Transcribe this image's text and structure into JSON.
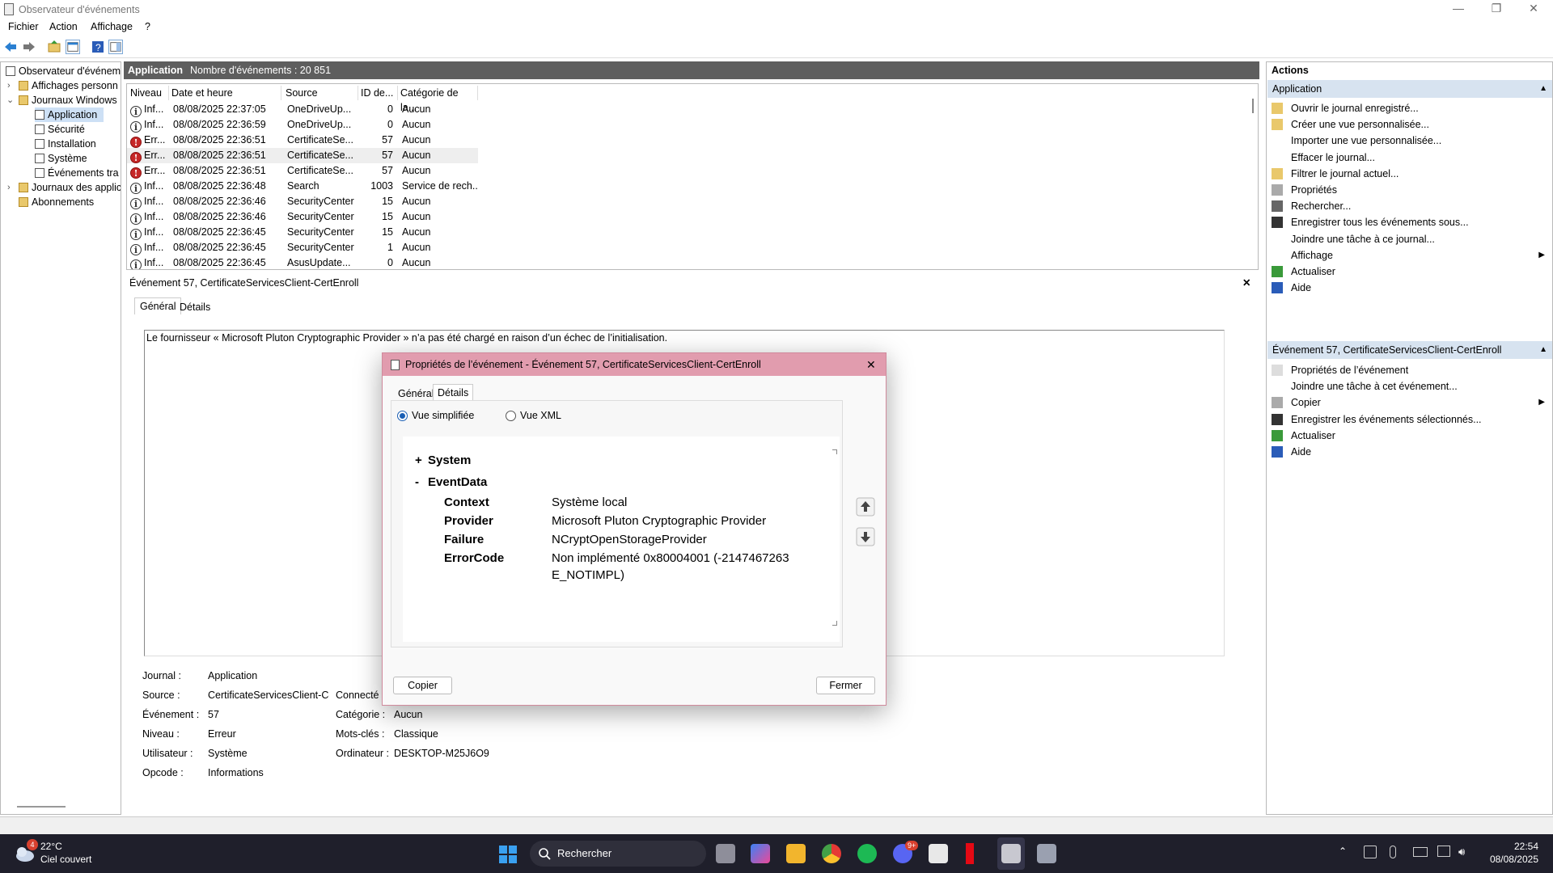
{
  "window": {
    "title": "Observateur d'événements",
    "minimize": "—",
    "maximize": "❐",
    "close": "✕"
  },
  "menu": [
    "Fichier",
    "Action",
    "Affichage",
    "?"
  ],
  "tree": {
    "root": "Observateur d'événem",
    "custom_views": "Affichages personn",
    "windows_logs": "Journaux Windows",
    "logs": [
      "Application",
      "Sécurité",
      "Installation",
      "Système",
      "Événements tra"
    ],
    "app_logs": "Journaux des applic",
    "subscriptions": "Abonnements"
  },
  "center_header": {
    "title": "Application",
    "count": "Nombre d'événements : 20 851"
  },
  "list": {
    "columns": [
      "Niveau",
      "Date et heure",
      "Source",
      "ID de...",
      "Catégorie de la..."
    ],
    "rows": [
      {
        "level": "Inf...",
        "kind": "info",
        "date": "08/08/2025 22:37:05",
        "source": "OneDriveUp...",
        "id": "0",
        "cat": "Aucun"
      },
      {
        "level": "Inf...",
        "kind": "info",
        "date": "08/08/2025 22:36:59",
        "source": "OneDriveUp...",
        "id": "0",
        "cat": "Aucun"
      },
      {
        "level": "Err...",
        "kind": "err",
        "date": "08/08/2025 22:36:51",
        "source": "CertificateSe...",
        "id": "57",
        "cat": "Aucun"
      },
      {
        "level": "Err...",
        "kind": "err",
        "date": "08/08/2025 22:36:51",
        "source": "CertificateSe...",
        "id": "57",
        "cat": "Aucun"
      },
      {
        "level": "Err...",
        "kind": "err",
        "date": "08/08/2025 22:36:51",
        "source": "CertificateSe...",
        "id": "57",
        "cat": "Aucun"
      },
      {
        "level": "Inf...",
        "kind": "info",
        "date": "08/08/2025 22:36:48",
        "source": "Search",
        "id": "1003",
        "cat": "Service de rech..."
      },
      {
        "level": "Inf...",
        "kind": "info",
        "date": "08/08/2025 22:36:46",
        "source": "SecurityCenter",
        "id": "15",
        "cat": "Aucun"
      },
      {
        "level": "Inf...",
        "kind": "info",
        "date": "08/08/2025 22:36:46",
        "source": "SecurityCenter",
        "id": "15",
        "cat": "Aucun"
      },
      {
        "level": "Inf...",
        "kind": "info",
        "date": "08/08/2025 22:36:45",
        "source": "SecurityCenter",
        "id": "15",
        "cat": "Aucun"
      },
      {
        "level": "Inf...",
        "kind": "info",
        "date": "08/08/2025 22:36:45",
        "source": "SecurityCenter",
        "id": "1",
        "cat": "Aucun"
      },
      {
        "level": "Inf...",
        "kind": "info",
        "date": "08/08/2025 22:36:45",
        "source": "AsusUpdate...",
        "id": "0",
        "cat": "Aucun"
      }
    ]
  },
  "detail": {
    "header": "Événement 57, CertificateServicesClient-CertEnroll",
    "close": "✕",
    "tabs": [
      "Général",
      "Détails"
    ],
    "message": "Le fournisseur « Microsoft Pluton Cryptographic Provider » n’a pas été chargé en raison d’un échec de l’initialisation.",
    "fields": {
      "journal_label": "Journal :",
      "journal": "Application",
      "source_label": "Source :",
      "source": "CertificateServicesClient-Cer",
      "connected_label": "Connecté :",
      "event_label": "Événement :",
      "event": "57",
      "category_label": "Catégorie :",
      "category": "Aucun",
      "level_label": "Niveau :",
      "level": "Erreur",
      "keywords_label": "Mots-clés :",
      "keywords": "Classique",
      "user_label": "Utilisateur :",
      "user": "Système",
      "computer_label": "Ordinateur :",
      "computer": "DESKTOP-M25J6O9",
      "opcode_label": "Opcode :",
      "opcode": "Informations"
    }
  },
  "actions": {
    "section1": "Application",
    "items1": [
      "Ouvrir le journal enregistré...",
      "Créer une vue personnalisée...",
      "Importer une vue personnalisée...",
      "Effacer le journal...",
      "Filtrer le journal actuel...",
      "Propriétés",
      "Rechercher...",
      "Enregistrer tous les événements sous...",
      "Joindre une tâche à ce journal...",
      "Affichage",
      "Actualiser",
      "Aide"
    ],
    "section2": "Événement 57, CertificateServicesClient-CertEnroll",
    "items2": [
      "Propriétés de l’événement",
      "Joindre une tâche à cet événement...",
      "Copier",
      "Enregistrer les événements sélectionnés...",
      "Actualiser",
      "Aide"
    ]
  },
  "dialog": {
    "title": "Propriétés de l’événement - Événement 57, CertificateServicesClient-CertEnroll",
    "close": "✕",
    "tabs": [
      "Général",
      "Détails"
    ],
    "radio_simple": "Vue simplifiée",
    "radio_xml": "Vue XML",
    "system": "System",
    "eventdata": "EventData",
    "plus": "+",
    "minus": "-",
    "data": [
      {
        "k": "Context",
        "v": "Système local"
      },
      {
        "k": "Provider",
        "v": "Microsoft Pluton Cryptographic Provider"
      },
      {
        "k": "Failure",
        "v": "NCryptOpenStorageProvider"
      },
      {
        "k": "ErrorCode",
        "v": "Non implémenté 0x80004001 (-2147467263"
      }
    ],
    "errorcode_line2": "E_NOTIMPL)",
    "copy": "Copier",
    "close_btn": "Fermer"
  },
  "taskbar": {
    "temp": "22°C",
    "weather": "Ciel couvert",
    "badge": "4",
    "search": "Rechercher",
    "time": "22:54",
    "date": "08/08/2025",
    "discord_badge": "9+"
  }
}
